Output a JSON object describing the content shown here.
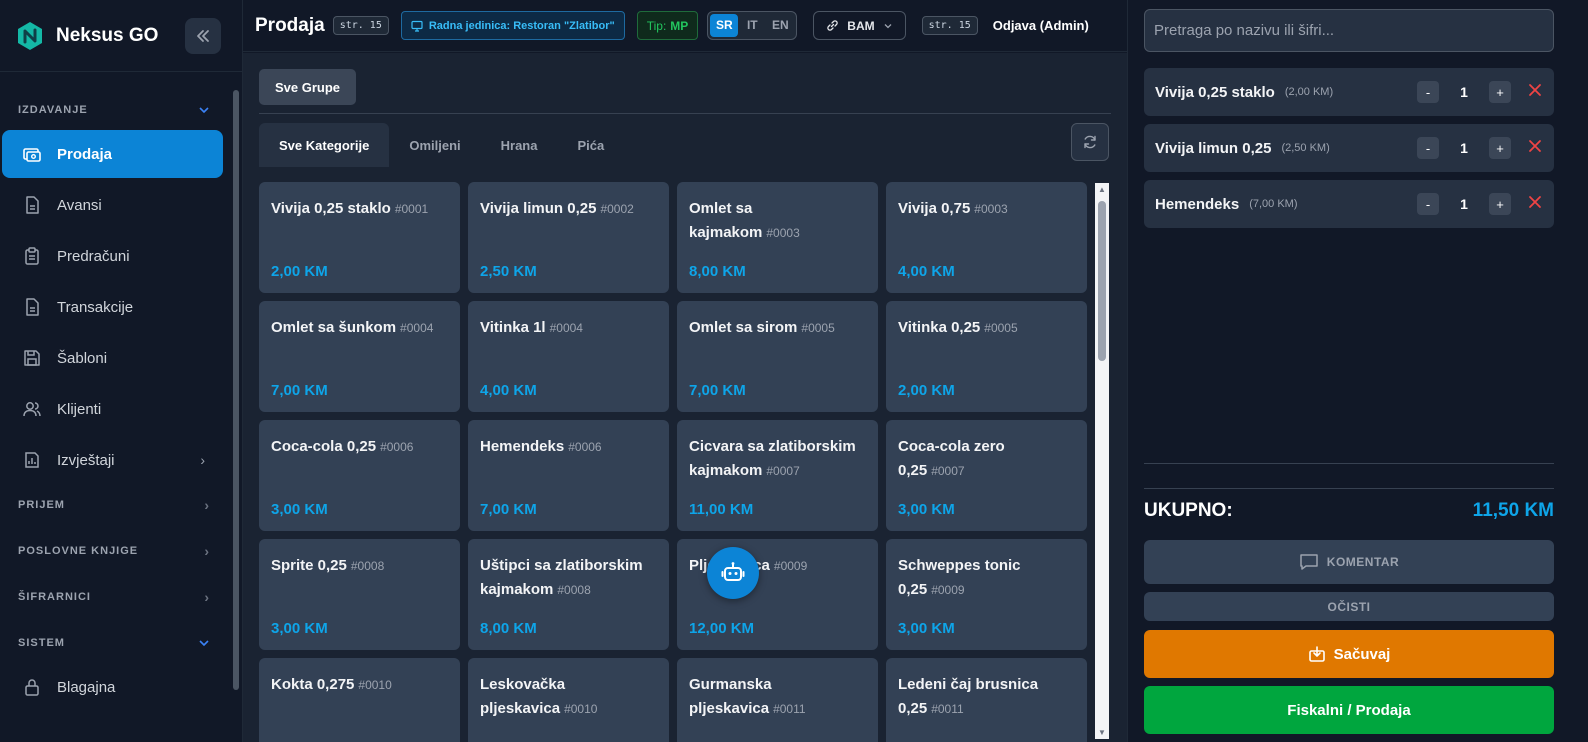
{
  "sidebar": {
    "brand": "Neksus GO",
    "sections": {
      "izdavanje": "IZDAVANJE",
      "prijem": "PRIJEM",
      "poslovne": "POSLOVNE KNJIGE",
      "sifrarnici": "ŠIFRARNICI",
      "sistem": "SISTEM"
    },
    "items": {
      "prodaja": "Prodaja",
      "avansi": "Avansi",
      "predracuni": "Predračuni",
      "transakcije": "Transakcije",
      "sabloni": "Šabloni",
      "klijenti": "Klijenti",
      "izvjestaji": "Izvještaji",
      "blagajna": "Blagajna"
    }
  },
  "topbar": {
    "title": "Prodaja",
    "page_tag": "str. 15",
    "unit": "Radna jedinica: Restoran \"Zlatibor\"",
    "tip_label": "Tip:",
    "tip_value": "MP",
    "languages": [
      "SR",
      "IT",
      "EN"
    ],
    "active_language": "SR",
    "currency": "BAM",
    "page_tag_2": "str. 15",
    "logout": "Odjava (Admin)"
  },
  "main": {
    "groups_button": "Sve Grupe",
    "tabs": [
      "Sve Kategorije",
      "Omiljeni",
      "Hrana",
      "Pića"
    ],
    "active_tab": "Sve Kategorije",
    "products": [
      {
        "name": "Vivija 0,25 staklo",
        "code": "#0001",
        "price": "2,00 KM"
      },
      {
        "name": "Vivija limun 0,25",
        "code": "#0002",
        "price": "2,50 KM"
      },
      {
        "name": "Omlet sa kajmakom",
        "code": "#0003",
        "price": "8,00 KM"
      },
      {
        "name": "Vivija 0,75",
        "code": "#0003",
        "price": "4,00 KM"
      },
      {
        "name": "Omlet sa šunkom",
        "code": "#0004",
        "price": "7,00 KM"
      },
      {
        "name": "Vitinka 1l",
        "code": "#0004",
        "price": "4,00 KM"
      },
      {
        "name": "Omlet sa sirom",
        "code": "#0005",
        "price": "7,00 KM"
      },
      {
        "name": "Vitinka 0,25",
        "code": "#0005",
        "price": "2,00 KM"
      },
      {
        "name": "Coca-cola 0,25",
        "code": "#0006",
        "price": "3,00 KM"
      },
      {
        "name": "Hemendeks",
        "code": "#0006",
        "price": "7,00 KM"
      },
      {
        "name": "Cicvara sa zlatiborskim kajmakom",
        "code": "#0007",
        "price": "11,00 KM"
      },
      {
        "name": "Coca-cola zero 0,25",
        "code": "#0007",
        "price": "3,00 KM"
      },
      {
        "name": "Sprite 0,25",
        "code": "#0008",
        "price": "3,00 KM"
      },
      {
        "name": "Uštipci sa zlatiborskim kajmakom",
        "code": "#0008",
        "price": "8,00 KM"
      },
      {
        "name": "Pljeskavica",
        "code": "#0009",
        "price": "12,00 KM"
      },
      {
        "name": "Schweppes tonic 0,25",
        "code": "#0009",
        "price": "3,00 KM"
      },
      {
        "name": "Kokta 0,275",
        "code": "#0010",
        "price": ""
      },
      {
        "name": "Leskovačka pljeskavica",
        "code": "#0010",
        "price": ""
      },
      {
        "name": "Gurmanska pljeskavica",
        "code": "#0011",
        "price": ""
      },
      {
        "name": "Ledeni čaj brusnica 0,25",
        "code": "#0011",
        "price": ""
      }
    ]
  },
  "cart": {
    "search_placeholder": "Pretraga po nazivu ili šifri...",
    "items": [
      {
        "name": "Vivija 0,25 staklo",
        "unit_price": "(2,00 KM)",
        "qty": "1"
      },
      {
        "name": "Vivija limun 0,25",
        "unit_price": "(2,50 KM)",
        "qty": "1"
      },
      {
        "name": "Hemendeks",
        "unit_price": "(7,00 KM)",
        "qty": "1"
      }
    ],
    "minus": "-",
    "plus": "+",
    "total_label": "UKUPNO:",
    "total_value": "11,50 KM",
    "comment_button": "KOMENTAR",
    "clear_button": "OČISTI",
    "save_button": "Sačuvaj",
    "fiscal_button": "Fiskalni / Prodaja"
  },
  "colors": {
    "accent": "#0c84d6",
    "price": "#0ea5e9",
    "save": "#e07800",
    "fiscal": "#00a63e",
    "remove": "#ef4444"
  },
  "icons": [
    "logo-icon",
    "double-chevron-left-icon",
    "cash-icon",
    "document-icon",
    "clipboard-icon",
    "save-icon",
    "users-icon",
    "chart-icon",
    "lock-icon",
    "monitor-icon",
    "link-icon",
    "chevron-down-icon",
    "refresh-icon",
    "robot-icon",
    "comment-icon",
    "download-icon",
    "close-icon"
  ]
}
